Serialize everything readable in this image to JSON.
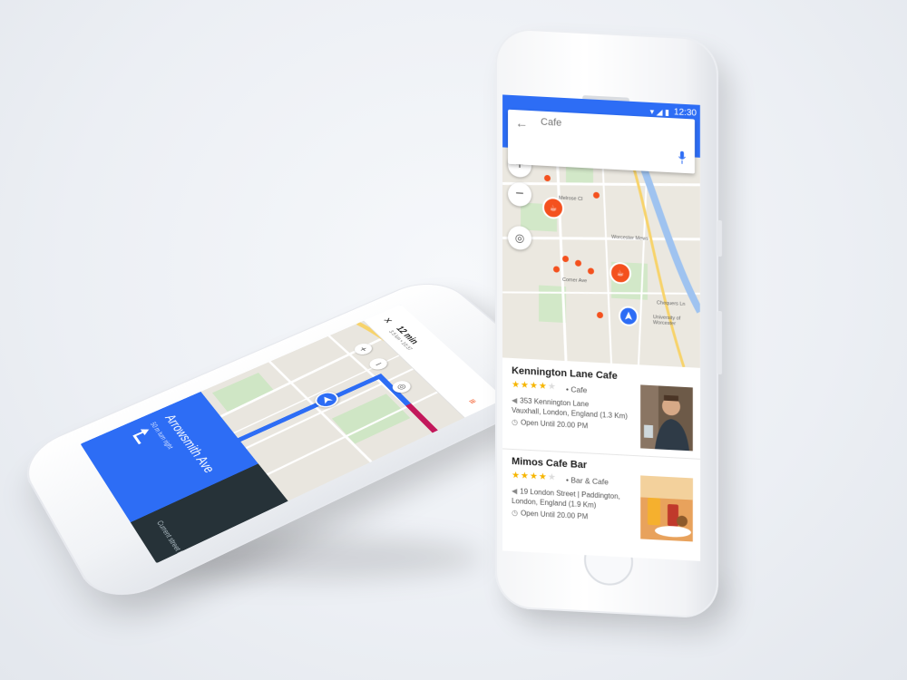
{
  "search_phone": {
    "status_time": "12:30",
    "search": {
      "placeholder": "Cafe"
    },
    "results": [
      {
        "name": "Kennington Lane Cafe",
        "rating": 4,
        "category": "Cafe",
        "address_line1": "353 Kennington Lane",
        "address_line2": "Vauxhall, London, England (1.3 Km)",
        "hours": "Open Until 20.00 PM"
      },
      {
        "name": "Mimos Cafe Bar",
        "rating": 4,
        "category": "Bar & Cafe",
        "address_line1": "19 London Street | Paddington,",
        "address_line2": "London, England (1.9 Km)",
        "hours": "Open Until 20.00 PM"
      }
    ],
    "map_labels": [
      "Melrose Cl",
      "Worcester Mews",
      "Comer Ave",
      "University of Worcester",
      "Chequers Ln"
    ]
  },
  "nav_phone": {
    "distance_hint": "50 m turn right",
    "street": "Arrowsmith Ave",
    "current_street_label": "Current street",
    "current_street": "Nelson Road",
    "eta": "12 min",
    "eta_details": "3.5 km • 10:37"
  },
  "colors": {
    "accent": "#2d6df5",
    "pin": "#f4511e",
    "star": "#f6b500",
    "banner_dark": "#263238"
  },
  "icons": [
    "back-arrow-icon",
    "mic-icon",
    "zoom-in-icon",
    "zoom-out-icon",
    "locate-icon",
    "location-pin-icon",
    "clock-icon",
    "turn-right-icon",
    "close-icon",
    "menu-icon",
    "navigation-arrow-icon"
  ]
}
